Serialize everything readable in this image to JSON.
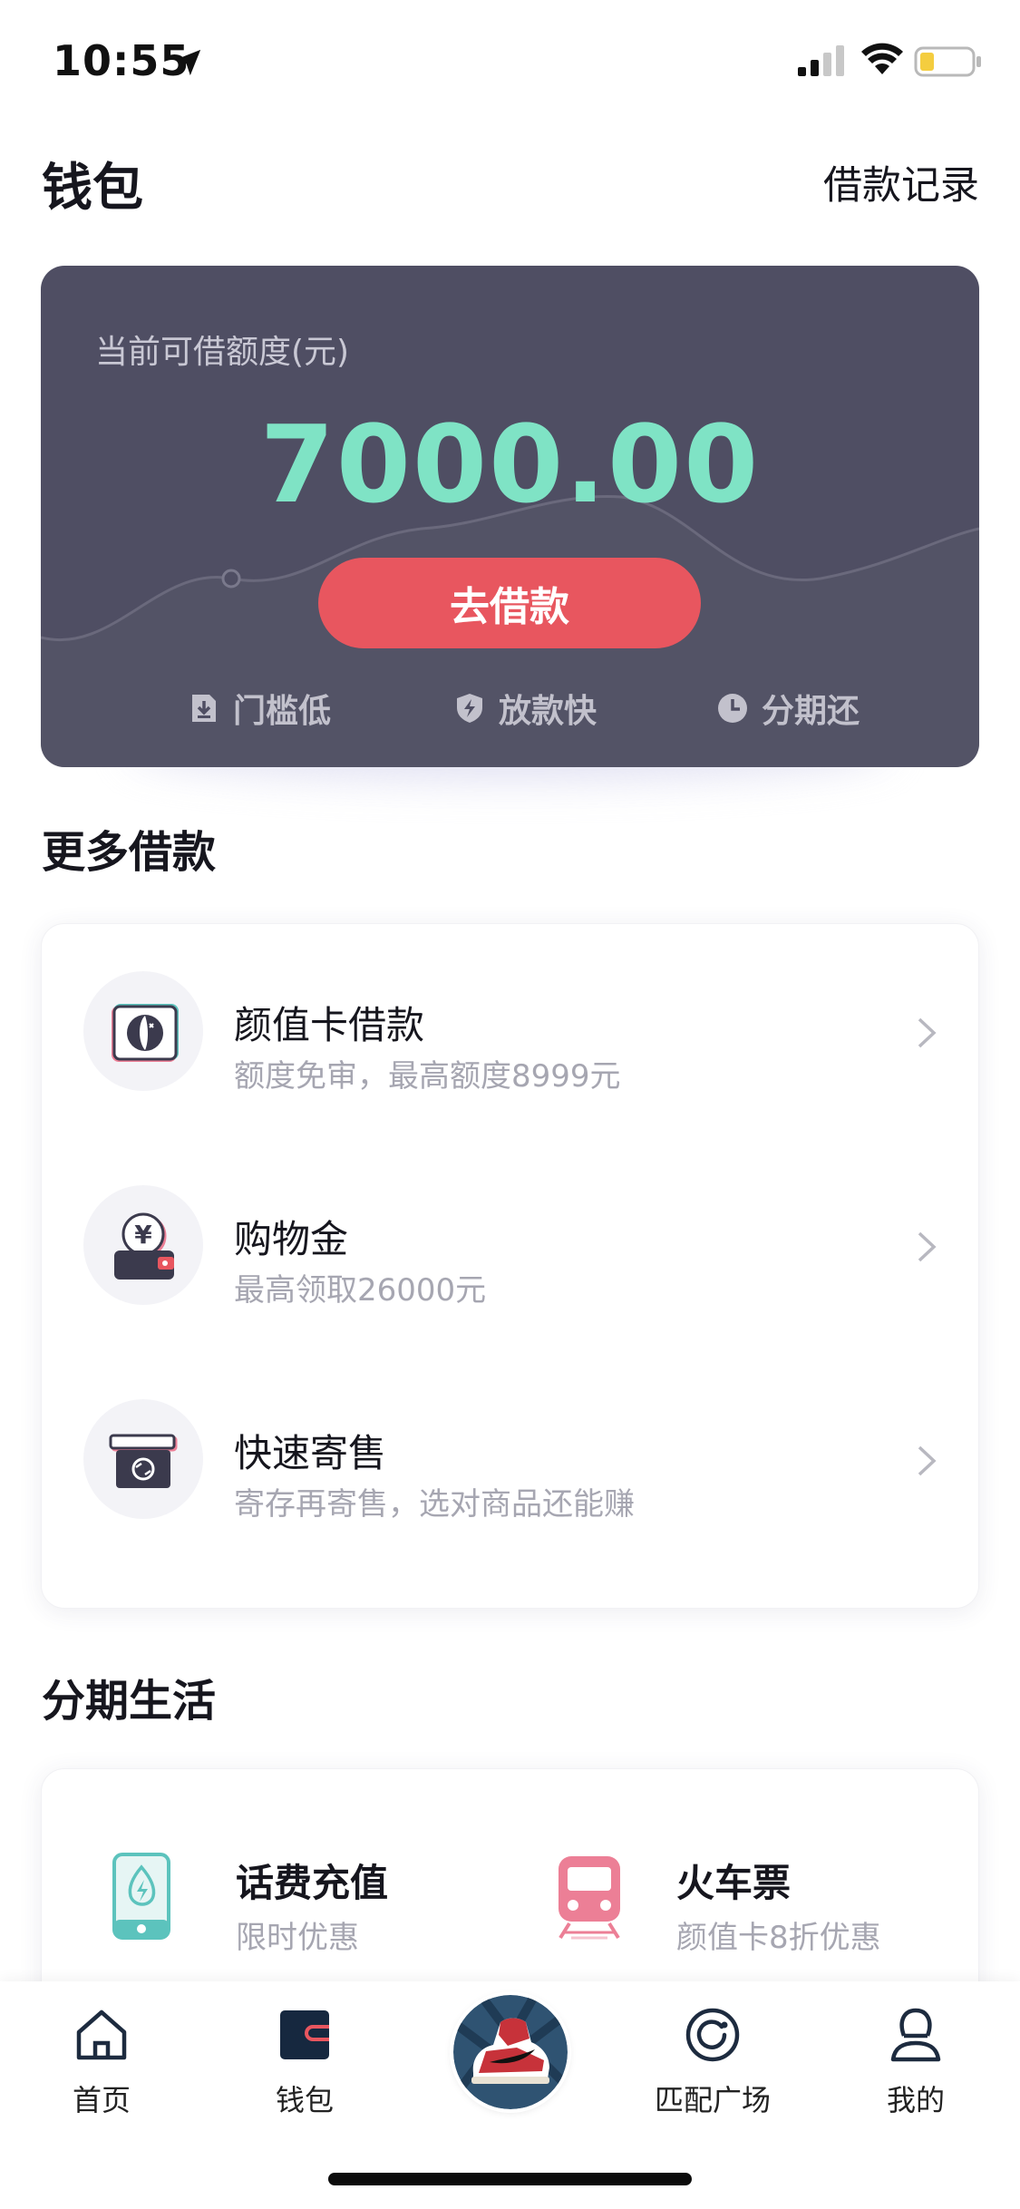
{
  "status_bar": {
    "time": "10:55"
  },
  "header": {
    "title": "钱包",
    "records_link": "借款记录"
  },
  "credit_card": {
    "label": "当前可借额度(元)",
    "amount": "7000.00",
    "borrow_button": "去借款",
    "features": [
      {
        "label": "门槛低",
        "icon": "download-doc-icon"
      },
      {
        "label": "放款快",
        "icon": "shield-bolt-icon"
      },
      {
        "label": "分期还",
        "icon": "clock-icon"
      }
    ]
  },
  "more_loans": {
    "title": "更多借款",
    "items": [
      {
        "title": "颜值卡借款",
        "subtitle": "额度免审，最高额度8999元",
        "icon": "face-card-icon"
      },
      {
        "title": "购物金",
        "subtitle": "最高领取26000元",
        "icon": "yen-wallet-icon"
      },
      {
        "title": "快速寄售",
        "subtitle": "寄存再寄售，选对商品还能赚",
        "icon": "consign-box-icon"
      }
    ]
  },
  "installment_life": {
    "title": "分期生活",
    "items": [
      {
        "title": "话费充值",
        "subtitle": "限时优惠",
        "icon": "phone-recharge-icon"
      },
      {
        "title": "火车票",
        "subtitle": "颜值卡8折优惠",
        "icon": "train-icon"
      }
    ]
  },
  "tab_bar": {
    "items": [
      {
        "label": "首页",
        "icon": "home-icon"
      },
      {
        "label": "钱包",
        "icon": "wallet-icon",
        "active": true
      },
      {
        "label": "",
        "icon": "sneaker-center-icon"
      },
      {
        "label": "匹配广场",
        "icon": "match-plaza-icon"
      },
      {
        "label": "我的",
        "icon": "profile-icon"
      }
    ]
  },
  "colors": {
    "card_bg": "#4f4e63",
    "amount": "#7fe3c5",
    "accent_red": "#e8565f",
    "muted_text": "#a6a6b1",
    "teal": "#5cc3bd",
    "pink": "#ec7f96"
  }
}
